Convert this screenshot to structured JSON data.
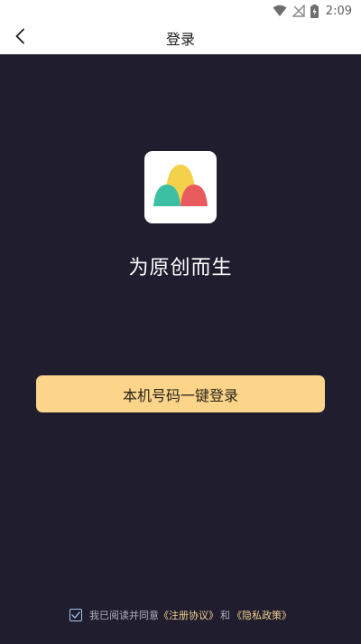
{
  "status_bar": {
    "time": "2:09"
  },
  "nav": {
    "title": "登录"
  },
  "main": {
    "tagline": "为原创而生"
  },
  "login_button": {
    "label": "本机号码一键登录"
  },
  "agreement": {
    "checked": true,
    "prefix": "我已阅读并同意",
    "terms_link": "《注册协议》",
    "conjunction": "和",
    "privacy_link": "《隐私政策》"
  },
  "colors": {
    "background": "#1f1d2e",
    "button": "#fcd58b",
    "link": "#f2cf8d",
    "logo_yellow": "#f4d14b",
    "logo_teal": "#3cbfa3",
    "logo_red": "#e85a5e"
  },
  "icons": {
    "back": "back-arrow-icon",
    "wifi": "wifi-icon",
    "signal": "no-signal-icon",
    "battery": "battery-charging-icon",
    "check": "checkmark-icon"
  }
}
